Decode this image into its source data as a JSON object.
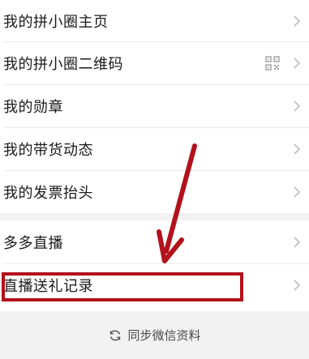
{
  "menu": {
    "group1": [
      {
        "label": "我的拼小圈主页"
      },
      {
        "label": "我的拼小圈二维码"
      },
      {
        "label": "我的勋章"
      },
      {
        "label": "我的带货动态"
      },
      {
        "label": "我的发票抬头"
      }
    ],
    "group2": [
      {
        "label": "多多直播"
      },
      {
        "label": "直播送礼记录"
      }
    ]
  },
  "footer": {
    "sync_label": "同步微信资料"
  },
  "icons": {
    "chevron": "chevron-right-icon",
    "qr": "qr-code-icon",
    "sync": "refresh-icon"
  },
  "colors": {
    "annotation": "#b3111b",
    "divider": "#ececec",
    "background_gray": "#f2f2f2"
  }
}
